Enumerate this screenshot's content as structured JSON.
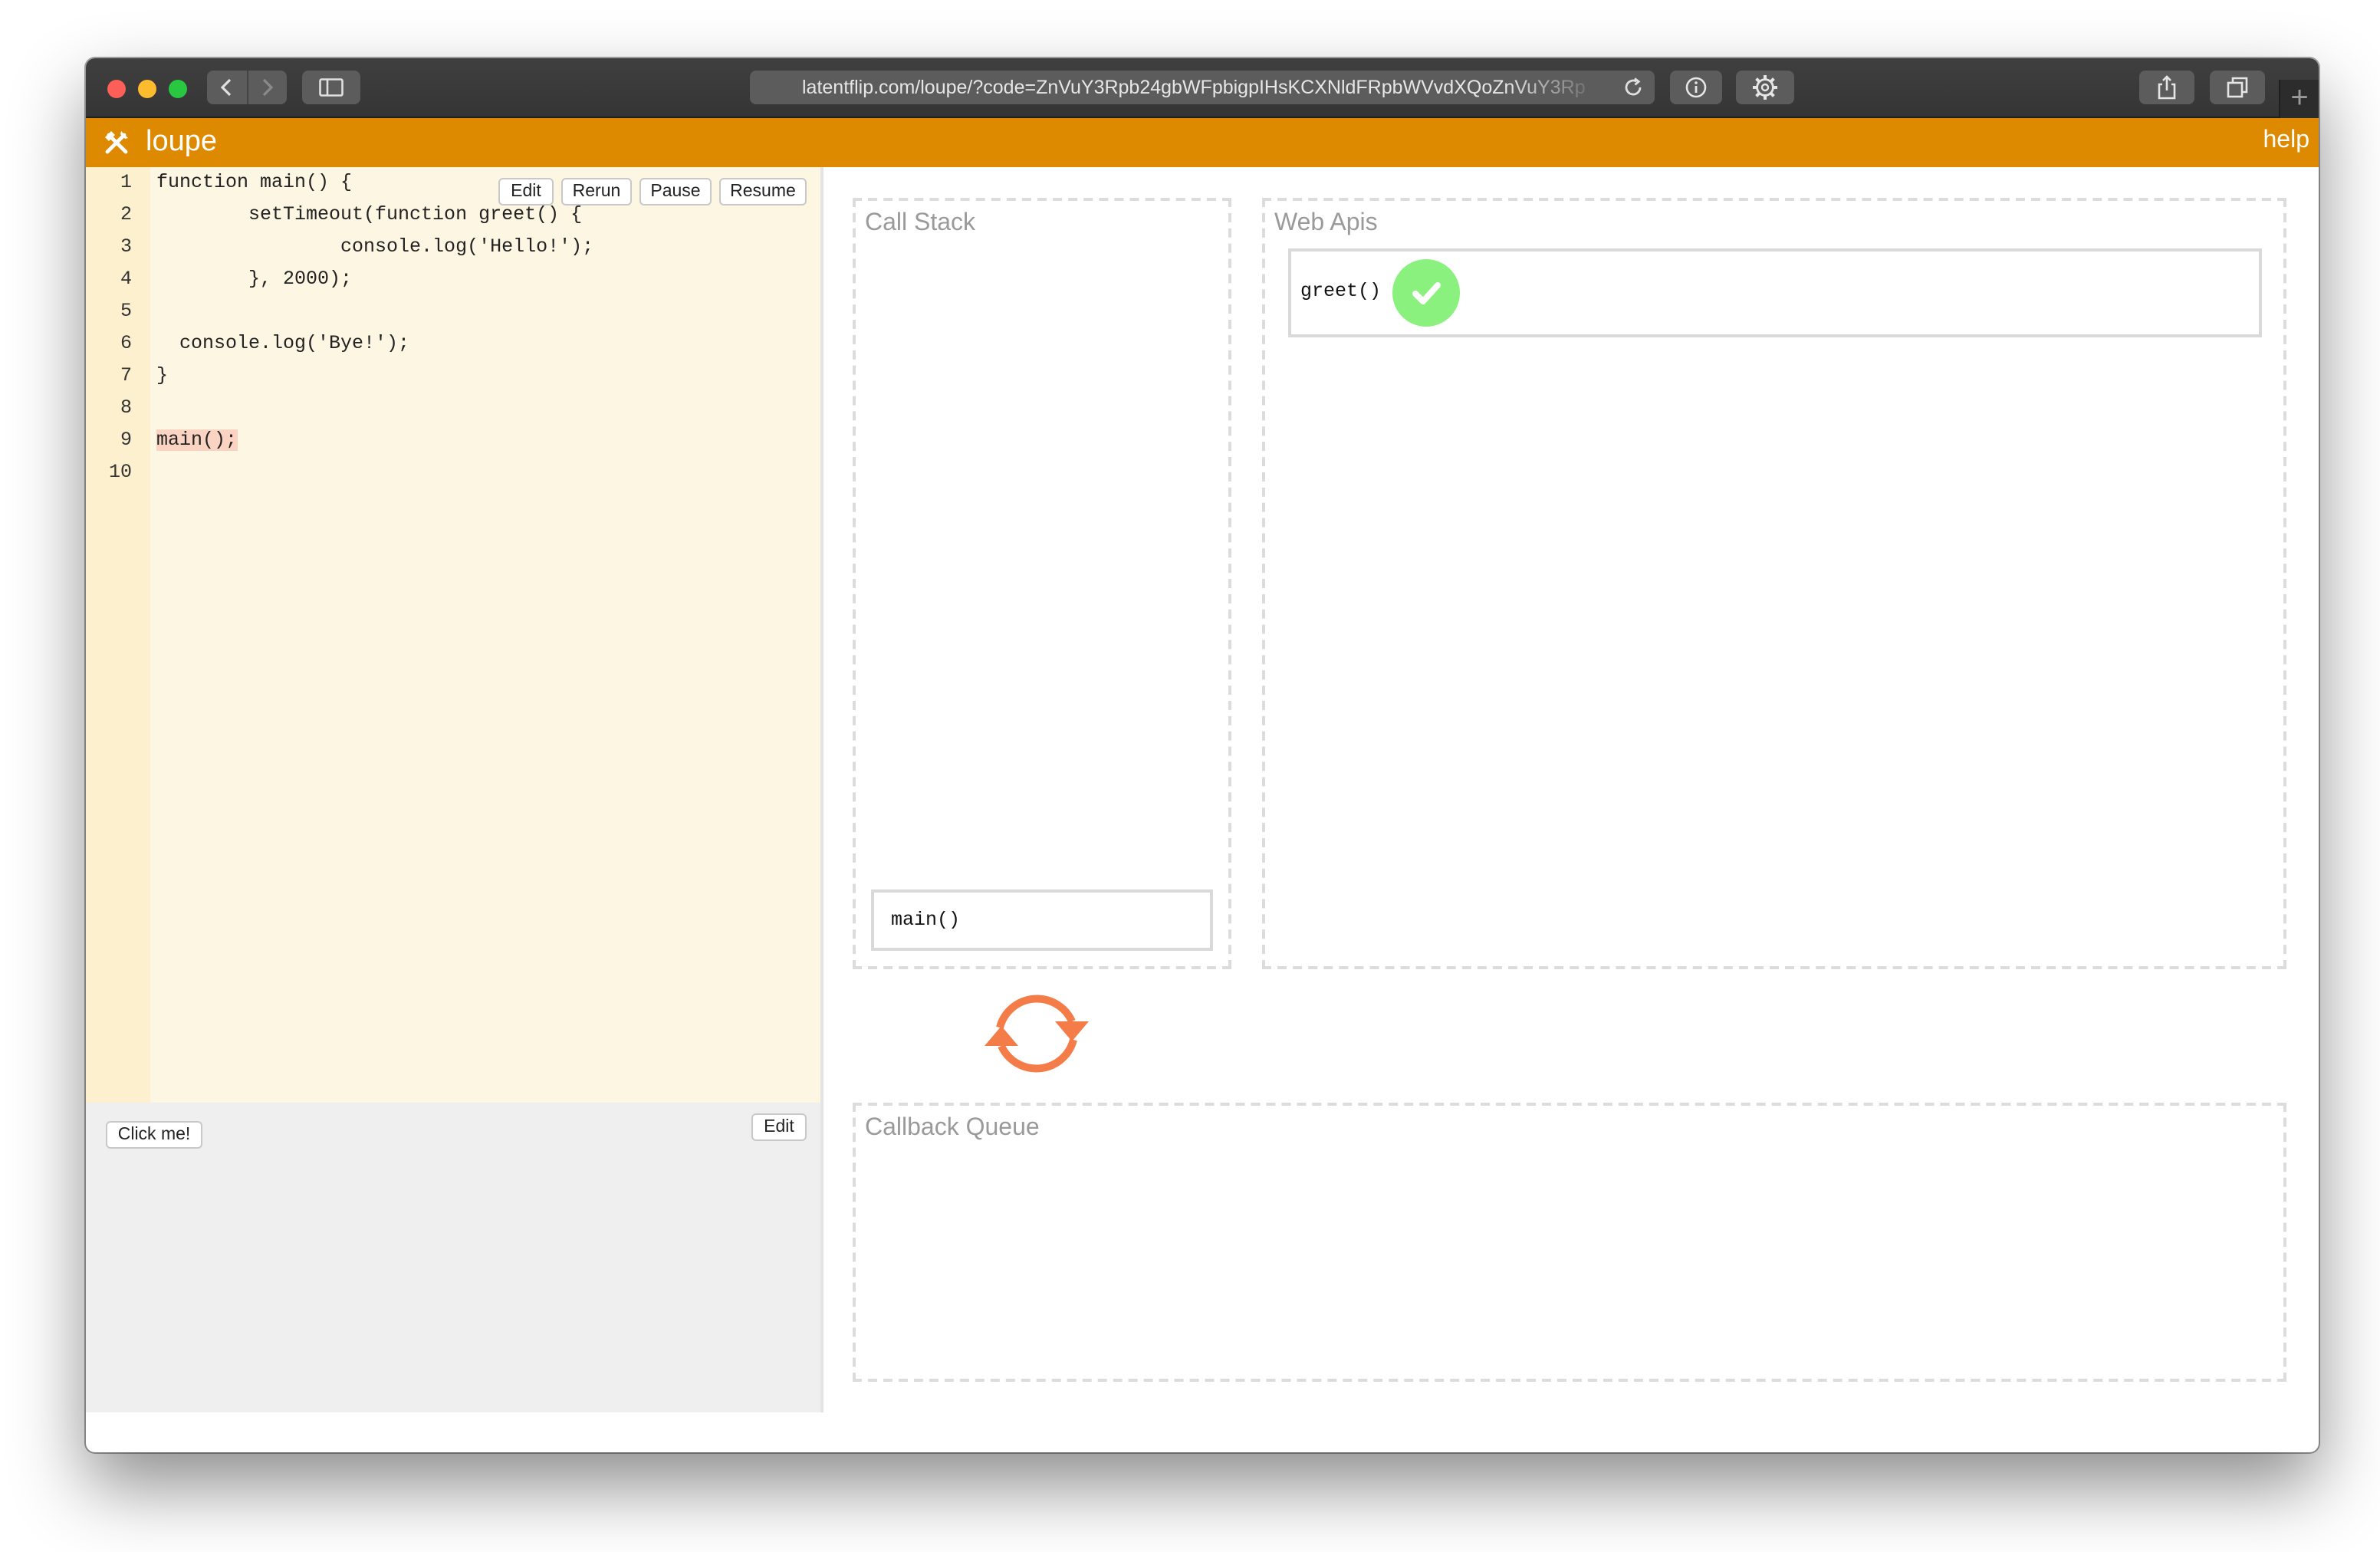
{
  "browser": {
    "url": "latentflip.com/loupe/?code=ZnVuY3Rpb24gbWFpbigpIHsKCXNldFRpbWVvdXQoZnVuY3Rp",
    "buttons": {
      "back_icon": "chevron-left-icon",
      "forward_icon": "chevron-right-icon",
      "sidebar_icon": "sidebar-icon",
      "reload_icon": "reload-icon",
      "info_icon": "info-icon",
      "settings_icon": "gear-icon",
      "share_icon": "share-icon",
      "tabs_icon": "tabs-icon",
      "new_tab_label": "+"
    }
  },
  "app": {
    "title": "loupe",
    "logo_icon": "tools-icon",
    "help_label": "help",
    "accent_color": "#de8a00"
  },
  "editor": {
    "buttons": [
      "Edit",
      "Rerun",
      "Pause",
      "Resume"
    ],
    "line_numbers": [
      "1",
      "2",
      "3",
      "4",
      "5",
      "6",
      "7",
      "8",
      "9",
      "10"
    ],
    "code_lines": [
      "function main() {",
      "        setTimeout(function greet() {",
      "                console.log('Hello!');",
      "        }, 2000);",
      "",
      "  console.log('Bye!');",
      "}",
      "",
      "main();",
      ""
    ],
    "highlighted_line": 9
  },
  "output": {
    "click_button_label": "Click me!",
    "edit_button_label": "Edit"
  },
  "visualizer": {
    "call_stack": {
      "title": "Call Stack",
      "frames": [
        "main()"
      ]
    },
    "web_apis": {
      "title": "Web Apis",
      "items": [
        {
          "label": "greet()",
          "status_icon": "check-icon",
          "status_color": "#8af07e"
        }
      ]
    },
    "event_loop_icon": "loop-arrows-icon",
    "event_loop_color": "#f47c48",
    "callback_queue": {
      "title": "Callback Queue",
      "items": []
    }
  }
}
